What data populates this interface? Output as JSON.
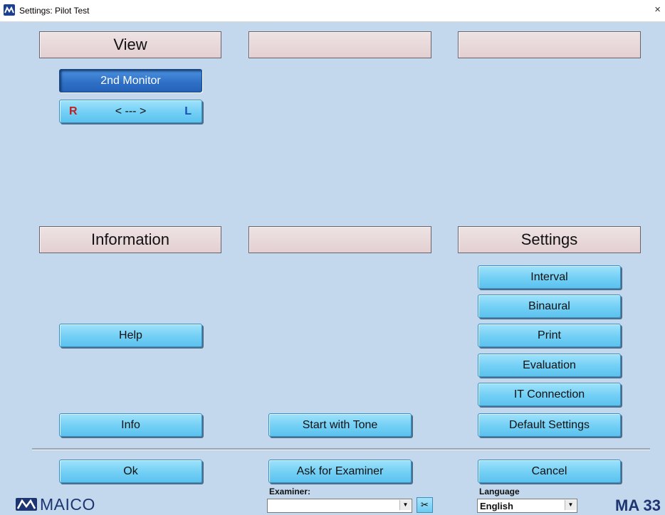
{
  "window": {
    "title": "Settings: Pilot Test",
    "close_glyph": "×"
  },
  "sections": {
    "view": "View",
    "top_middle": "",
    "top_right": "",
    "information": "Information",
    "bottom_middle": "",
    "settings": "Settings"
  },
  "view_buttons": {
    "second_monitor": "2nd Monitor",
    "rl_right": "R",
    "rl_arrow": "< --- >",
    "rl_left": "L"
  },
  "info_buttons": {
    "help": "Help",
    "info": "Info"
  },
  "middle_buttons": {
    "start_with_tone": "Start with Tone"
  },
  "settings_buttons": {
    "interval": "Interval",
    "binaural": "Binaural",
    "print": "Print",
    "evaluation": "Evaluation",
    "it_connection": "IT Connection",
    "default_settings": "Default Settings"
  },
  "footer": {
    "ok": "Ok",
    "ask_for_examiner": "Ask for Examiner",
    "cancel": "Cancel",
    "examiner_label": "Examiner:",
    "examiner_value": "",
    "language_label": "Language",
    "language_value": "English",
    "logo_text": "MAICO",
    "model": "MA 33",
    "scissors_glyph": "✂",
    "dropdown_glyph": "▼"
  },
  "icons": {
    "app": "maico-logo-icon",
    "close": "close-icon",
    "scissors": "scissors-icon",
    "dropdown": "chevron-down-icon"
  },
  "colors": {
    "background": "#c3d8ec",
    "button": "#72cff5",
    "button_active": "#2e6fc5",
    "header": "#e3cfd2",
    "brand": "#1d3570",
    "r_marker": "#c02020",
    "l_marker": "#1c4fb4"
  },
  "state": {
    "second_monitor_active": true
  }
}
